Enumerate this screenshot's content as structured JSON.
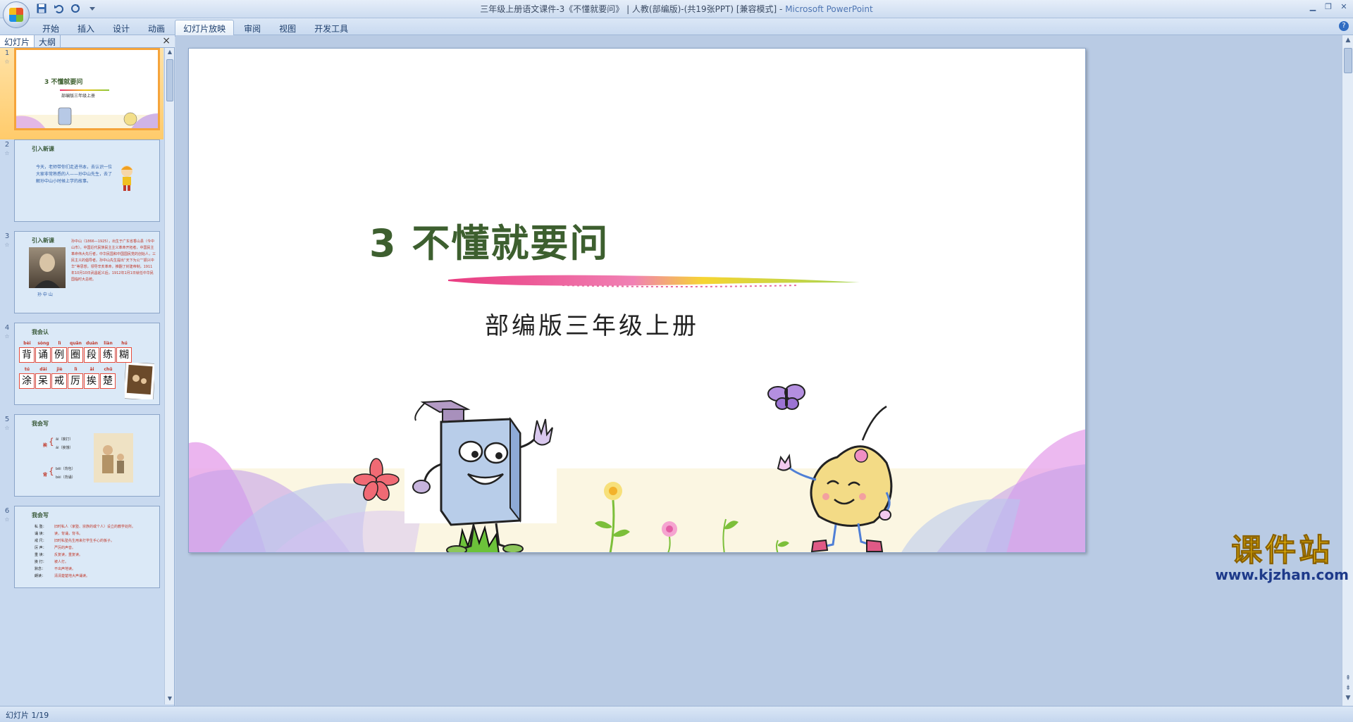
{
  "window": {
    "title": "三年级上册语文课件-3《不懂就要问》 | 人教(部编版)-(共19张PPT) [兼容模式] - ",
    "app_name": "Microsoft PowerPoint"
  },
  "qat": {
    "save_icon": "save-icon",
    "undo_icon": "undo-icon",
    "redo_icon": "redo-icon"
  },
  "ribbon": {
    "tabs": [
      "开始",
      "插入",
      "设计",
      "动画",
      "幻灯片放映",
      "审阅",
      "视图",
      "开发工具"
    ],
    "active_tab_index": 4
  },
  "pane": {
    "tabs": [
      "幻灯片",
      "大纲"
    ],
    "close": "×"
  },
  "thumbnails": [
    {
      "num": "1",
      "title": "3 不懂就要问",
      "sub": "部编版三年级上册"
    },
    {
      "num": "2",
      "heading": "引入新课",
      "text": "今天，老师带你们走进书本，去认识一位大家非常熟悉的人——孙中山先生，去了解孙中山小时候上学的故事。"
    },
    {
      "num": "3",
      "heading": "引入新课",
      "caption": "孙 中 山",
      "text": "孙中山（1866—1925），出生于广东省香山县（今中山市）。中国近代民族民主主义革命开拓者，中国民主革命伟大先行者，中华民国和中国国民党的创始人，三民主义的倡导者。孙中山先生提出“天下为公”“振兴中华”等思想，领导辛亥革命，推翻了封建帝制，1911年10月10日武昌起义后，1912年1月1日就任中华民国临时大总统。"
    },
    {
      "num": "4",
      "heading": "我会认",
      "row1_pinyin": [
        "bèi",
        "sòng",
        "lì",
        "quān",
        "duàn",
        "liàn",
        "hú"
      ],
      "row1_chars": [
        "背",
        "诵",
        "例",
        "圈",
        "段",
        "练",
        "糊"
      ],
      "row2_pinyin": [
        "tú",
        "dāi",
        "jiè",
        "lì",
        "āi",
        "chǔ"
      ],
      "row2_chars": [
        "涂",
        "呆",
        "戒",
        "厉",
        "挨",
        "楚"
      ]
    },
    {
      "num": "5",
      "heading": "我会写",
      "lines": [
        "挨",
        "āi（挨打）",
        "ái（挨饿）",
        "背",
        "bēi（背包）",
        "bèi（背诵）"
      ]
    },
    {
      "num": "6",
      "heading": "我会写",
      "terms": [
        "私 塾：",
        "诵 读：",
        "戒 尺：",
        "厉 声：",
        "重 读：",
        "挨 打：",
        "默念：",
        "朗读："
      ],
      "defs": [
        "旧时私人（家塾、宗族的或个人）设立的教学处所。",
        "读，背诵，背书。",
        "旧时私塾先生用来打学生手心的板子。",
        "严厉的声音。",
        "反复读，重复读。",
        "被人打。",
        "不出声地读。",
        "清清楚楚地大声诵读。"
      ]
    }
  ],
  "slide": {
    "title": "3  不懂就要问",
    "subtitle": "部编版三年级上册"
  },
  "watermark": {
    "main": "课件站",
    "url": "www.kjzhan.com"
  },
  "status": {
    "text": "幻灯片 1/19"
  }
}
